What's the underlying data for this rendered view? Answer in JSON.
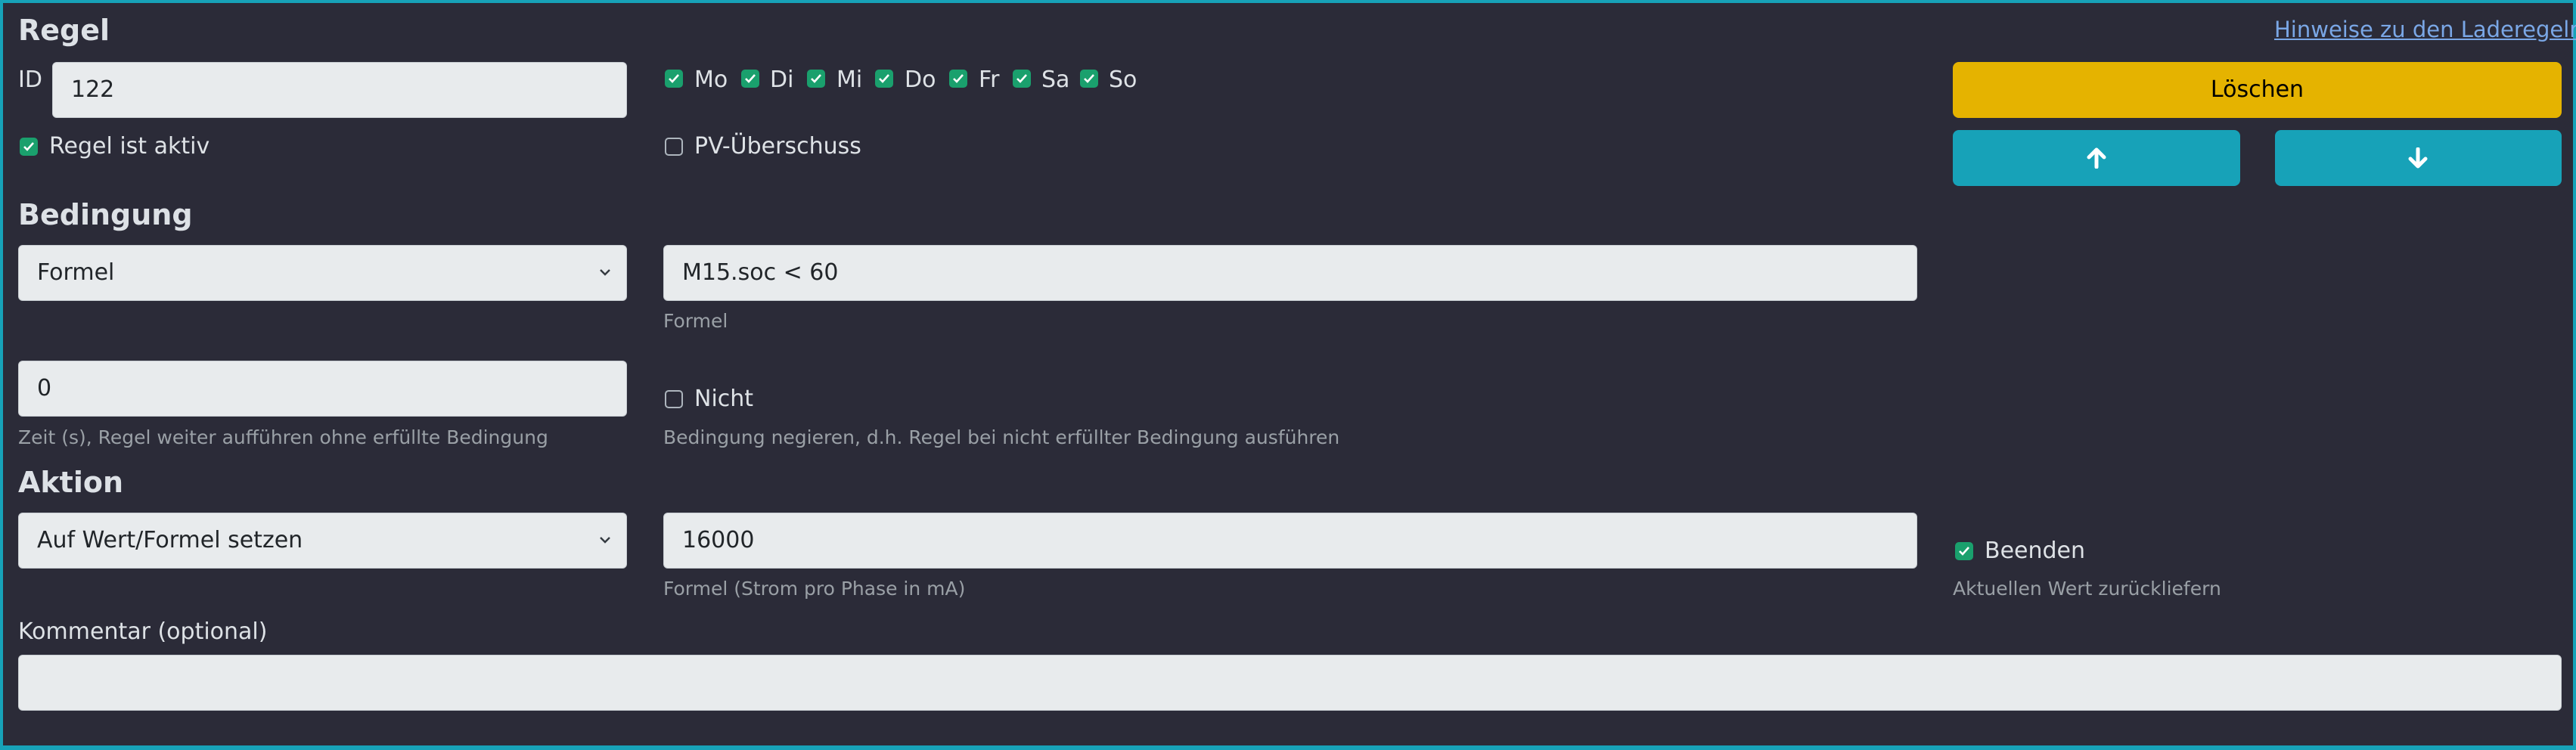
{
  "sections": {
    "regel": "Regel",
    "bedingung": "Bedingung",
    "aktion": "Aktion"
  },
  "help_link": "Hinweise zu den Laderegeln",
  "id_field": {
    "label": "ID",
    "value": "122"
  },
  "days": [
    {
      "label": "Mo",
      "checked": true
    },
    {
      "label": "Di",
      "checked": true
    },
    {
      "label": "Mi",
      "checked": true
    },
    {
      "label": "Do",
      "checked": true
    },
    {
      "label": "Fr",
      "checked": true
    },
    {
      "label": "Sa",
      "checked": true
    },
    {
      "label": "So",
      "checked": true
    }
  ],
  "rule_active": {
    "label": "Regel ist aktiv",
    "checked": true
  },
  "pv_surplus": {
    "label": "PV-Überschuss",
    "checked": false
  },
  "buttons": {
    "delete": "Löschen",
    "up_icon": "arrow-up-icon",
    "down_icon": "arrow-down-icon"
  },
  "condition": {
    "type_selected": "Formel",
    "formula_value": "M15.soc < 60",
    "formula_help": "Formel",
    "time_value": "0",
    "time_help": "Zeit (s), Regel weiter aufführen ohne erfüllte Bedingung",
    "negate_label": "Nicht",
    "negate_checked": false,
    "negate_help": "Bedingung negieren, d.h. Regel bei nicht erfüllter Bedingung ausführen"
  },
  "action": {
    "type_selected": "Auf Wert/Formel setzen",
    "value": "16000",
    "value_help": "Formel (Strom pro Phase in mA)",
    "stop_label": "Beenden",
    "stop_checked": true,
    "stop_help": "Aktuellen Wert zurückliefern"
  },
  "comment": {
    "label": "Kommentar (optional)",
    "value": ""
  },
  "colors": {
    "background": "#2b2b38",
    "border_accent": "#17a2b8",
    "delete_button": "#e5b300",
    "move_buttons": "#17a2b8",
    "checkbox_on": "#1aa06d"
  }
}
